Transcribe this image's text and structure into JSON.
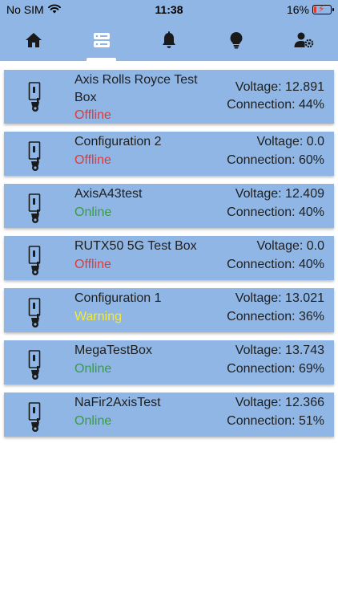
{
  "status_bar": {
    "carrier": "No SIM",
    "time": "11:38",
    "battery_text": "16%",
    "battery_level": 0.16,
    "icons": [
      "wifi-icon",
      "battery-icon",
      "charging-icon"
    ]
  },
  "nav": {
    "tabs": [
      {
        "icon": "home-icon"
      },
      {
        "icon": "server-icon",
        "active": true
      },
      {
        "icon": "bell-icon"
      },
      {
        "icon": "lightbulb-icon"
      },
      {
        "icon": "user-settings-icon"
      }
    ]
  },
  "colors": {
    "accent": "#8fb6e4",
    "offline": "#e53935",
    "online": "#3a9a4a",
    "warning": "#f2ea3a"
  },
  "devices": [
    {
      "name": "Axis Rolls Royce Test Box",
      "status": "Offline",
      "voltage": "Voltage: 12.891",
      "connection": "Connection: 44%",
      "icon": "camera-box-icon"
    },
    {
      "name": "Configuration 2",
      "status": "Offline",
      "voltage": "Voltage: 0.0",
      "connection": "Connection: 60%",
      "icon": "camera-box-icon"
    },
    {
      "name": "AxisA43test",
      "status": "Online",
      "voltage": "Voltage: 12.409",
      "connection": "Connection: 40%",
      "icon": "camera-box-icon"
    },
    {
      "name": "RUTX50 5G Test Box",
      "status": "Offline",
      "voltage": "Voltage: 0.0",
      "connection": "Connection: 40%",
      "icon": "camera-box-icon"
    },
    {
      "name": "Configuration 1",
      "status": "Warning",
      "voltage": "Voltage: 13.021",
      "connection": "Connection: 36%",
      "icon": "camera-box-icon"
    },
    {
      "name": "MegaTestBox",
      "status": "Online",
      "voltage": "Voltage: 13.743",
      "connection": "Connection: 69%",
      "icon": "camera-box-icon"
    },
    {
      "name": "NaFir2AxisTest",
      "status": "Online",
      "voltage": "Voltage: 12.366",
      "connection": "Connection: 51%",
      "icon": "camera-box-icon"
    }
  ]
}
